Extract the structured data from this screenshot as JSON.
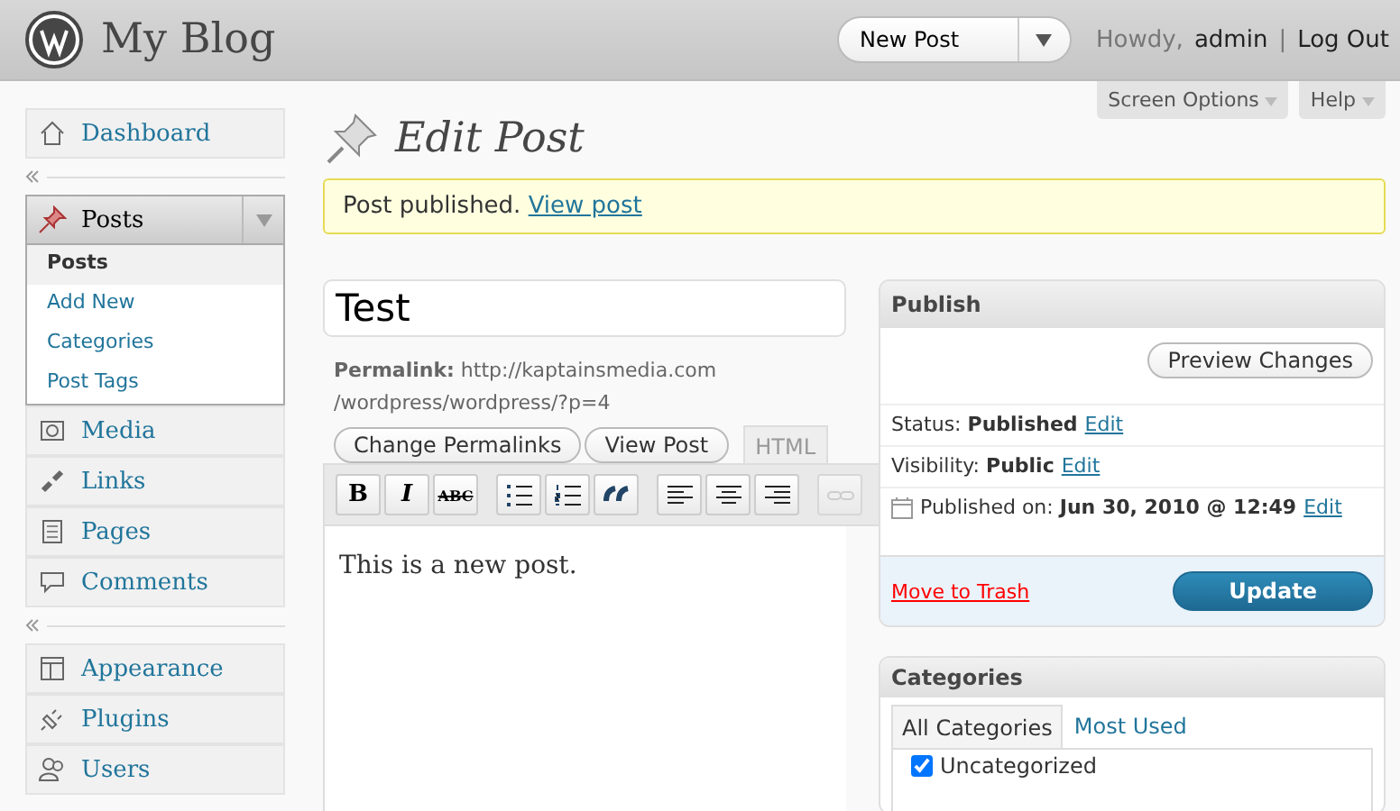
{
  "header": {
    "site_title": "My Blog",
    "quick_action": "New Post",
    "howdy": "Howdy,",
    "user": "admin",
    "separator": "|",
    "logout": "Log Out"
  },
  "screen_tabs": [
    "Screen Options",
    "Help"
  ],
  "sidebar": {
    "groups": [
      {
        "items": [
          {
            "label": "Dashboard",
            "expanded": false
          }
        ]
      },
      {
        "items": [
          {
            "label": "Posts",
            "expanded": true,
            "children": [
              {
                "label": "Posts",
                "selected": true
              },
              {
                "label": "Add New",
                "selected": false
              },
              {
                "label": "Categories",
                "selected": false
              },
              {
                "label": "Post Tags",
                "selected": false
              }
            ]
          },
          {
            "label": "Media",
            "expanded": false
          },
          {
            "label": "Links",
            "expanded": false
          },
          {
            "label": "Pages",
            "expanded": false
          },
          {
            "label": "Comments",
            "expanded": false
          }
        ]
      },
      {
        "items": [
          {
            "label": "Appearance",
            "expanded": false
          },
          {
            "label": "Plugins",
            "expanded": false
          },
          {
            "label": "Users",
            "expanded": false
          }
        ]
      }
    ]
  },
  "page_title": "Edit Post",
  "notice": {
    "text": "Post published.",
    "link": "View post"
  },
  "post": {
    "title": "Test",
    "permalink_label": "Permalink:",
    "permalink_lines": [
      "http://kaptainsmedia.com",
      "/wordpress/wordpress/?p=4"
    ],
    "buttons": [
      "Change Permalinks",
      "View Post"
    ],
    "editor_tab": "HTML",
    "toolbar": [
      {
        "kind": "bold",
        "label": "B"
      },
      {
        "kind": "italic",
        "label": "I"
      },
      {
        "kind": "strike",
        "label": "ABC"
      },
      {
        "kind": "bullets"
      },
      {
        "kind": "numbers"
      },
      {
        "kind": "quote"
      },
      {
        "kind": "left"
      },
      {
        "kind": "center"
      },
      {
        "kind": "right"
      },
      {
        "kind": "link",
        "disabled": true
      }
    ],
    "content": "This is a new post."
  },
  "publish": {
    "title": "Publish",
    "preview": "Preview Changes",
    "rows": [
      {
        "label": "Status:",
        "value": "Published",
        "link": "Edit"
      },
      {
        "label": "Visibility:",
        "value": "Public",
        "link": "Edit"
      },
      {
        "label": "Published on:",
        "value": "Jun 30, 2010 @ 12:49",
        "link": "Edit"
      }
    ],
    "trash": "Move to Trash",
    "update": "Update"
  },
  "categories": {
    "title": "Categories",
    "tabs": [
      {
        "label": "All Categories",
        "selected": true
      },
      {
        "label": "Most Used",
        "selected": false
      }
    ],
    "items": [
      {
        "label": "Uncategorized",
        "checked": true
      }
    ]
  }
}
